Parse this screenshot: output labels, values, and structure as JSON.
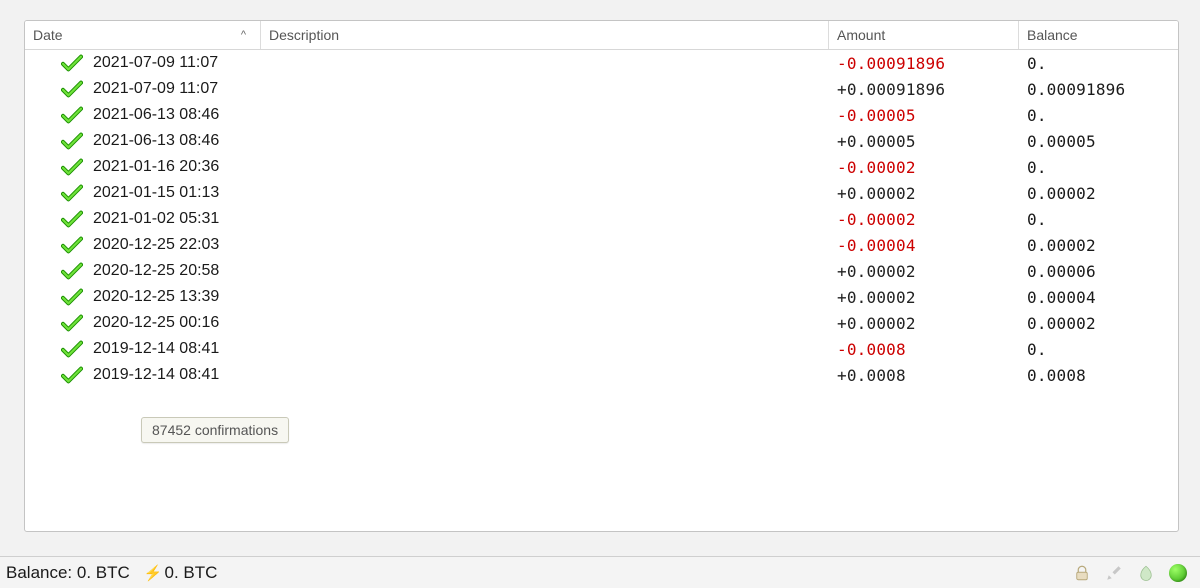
{
  "columns": {
    "date": "Date",
    "description": "Description",
    "amount": "Amount",
    "balance": "Balance"
  },
  "sort_indicator": "^",
  "transactions": [
    {
      "date": "2021-07-09 11:07",
      "description": "",
      "amount": "-0.00091896",
      "negative": true,
      "balance": "0."
    },
    {
      "date": "2021-07-09 11:07",
      "description": "",
      "amount": "+0.00091896",
      "negative": false,
      "balance": "0.00091896"
    },
    {
      "date": "2021-06-13 08:46",
      "description": "",
      "amount": "-0.00005",
      "negative": true,
      "balance": "0."
    },
    {
      "date": "2021-06-13 08:46",
      "description": "",
      "amount": "+0.00005",
      "negative": false,
      "balance": "0.00005"
    },
    {
      "date": "2021-01-16 20:36",
      "description": "",
      "amount": "-0.00002",
      "negative": true,
      "balance": "0."
    },
    {
      "date": "2021-01-15 01:13",
      "description": "",
      "amount": "+0.00002",
      "negative": false,
      "balance": "0.00002"
    },
    {
      "date": "2021-01-02 05:31",
      "description": "",
      "amount": "-0.00002",
      "negative": true,
      "balance": "0."
    },
    {
      "date": "2020-12-25 22:03",
      "description": "",
      "amount": "-0.00004",
      "negative": true,
      "balance": "0.00002"
    },
    {
      "date": "2020-12-25 20:58",
      "description": "",
      "amount": "+0.00002",
      "negative": false,
      "balance": "0.00006"
    },
    {
      "date": "2020-12-25 13:39",
      "description": "",
      "amount": "+0.00002",
      "negative": false,
      "balance": "0.00004"
    },
    {
      "date": "2020-12-25 00:16",
      "description": "",
      "amount": "+0.00002",
      "negative": false,
      "balance": "0.00002"
    },
    {
      "date": "2019-12-14 08:41",
      "description": "",
      "amount": "-0.0008",
      "negative": true,
      "balance": "0."
    },
    {
      "date": "2019-12-14 08:41",
      "description": "",
      "amount": "+0.0008",
      "negative": false,
      "balance": "0.0008"
    }
  ],
  "tooltip": "87452 confirmations",
  "status": {
    "balance_label": "Balance:",
    "balance_value": "0. BTC",
    "lightning_value": "0. BTC"
  },
  "icons": {
    "confirmed": "confirmed-check-icon",
    "lock": "lock-icon",
    "tools": "tools-icon",
    "seed": "seed-icon",
    "network": "network-status-icon"
  }
}
